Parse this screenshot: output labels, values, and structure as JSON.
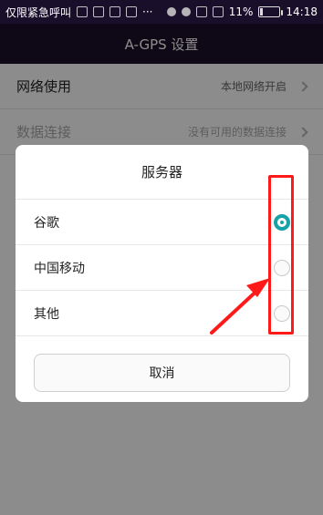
{
  "status_bar": {
    "carrier_text": "仅限紧急呼叫",
    "more_icon": "···",
    "battery_percent": "11%",
    "time": "14:18",
    "colors": {
      "bg": "#1a0f2a",
      "text": "#ffffff"
    }
  },
  "header": {
    "title": "A-GPS 设置"
  },
  "settings": {
    "rows": [
      {
        "label": "网络使用",
        "value": "本地网络开启"
      },
      {
        "label": "数据连接",
        "value": "没有可用的数据连接"
      }
    ]
  },
  "dialog": {
    "title": "服务器",
    "options": [
      {
        "label": "谷歌",
        "selected": true
      },
      {
        "label": "中国移动",
        "selected": false
      },
      {
        "label": "其他",
        "selected": false
      }
    ],
    "cancel_label": "取消",
    "colors": {
      "accent": "#16a2a8"
    }
  },
  "annotation": {
    "highlight_color": "#ff1a1a"
  }
}
